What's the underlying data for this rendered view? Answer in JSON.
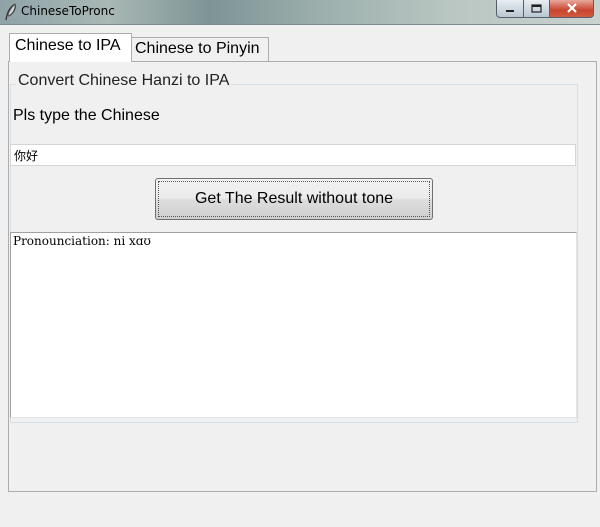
{
  "window": {
    "title": "ChineseToPronc",
    "icon": "feather-icon"
  },
  "tabs": [
    {
      "label": "Chinese to IPA",
      "active": true
    },
    {
      "label": "Chinese to Pinyin",
      "active": false
    }
  ],
  "main": {
    "frame_title": "Convert Chinese Hanzi to IPA",
    "prompt": "Pls type the Chinese",
    "input_value": "你好",
    "button_label": "Get The Result without tone",
    "output_text": "Pronounciation: ni xɑʊ"
  }
}
